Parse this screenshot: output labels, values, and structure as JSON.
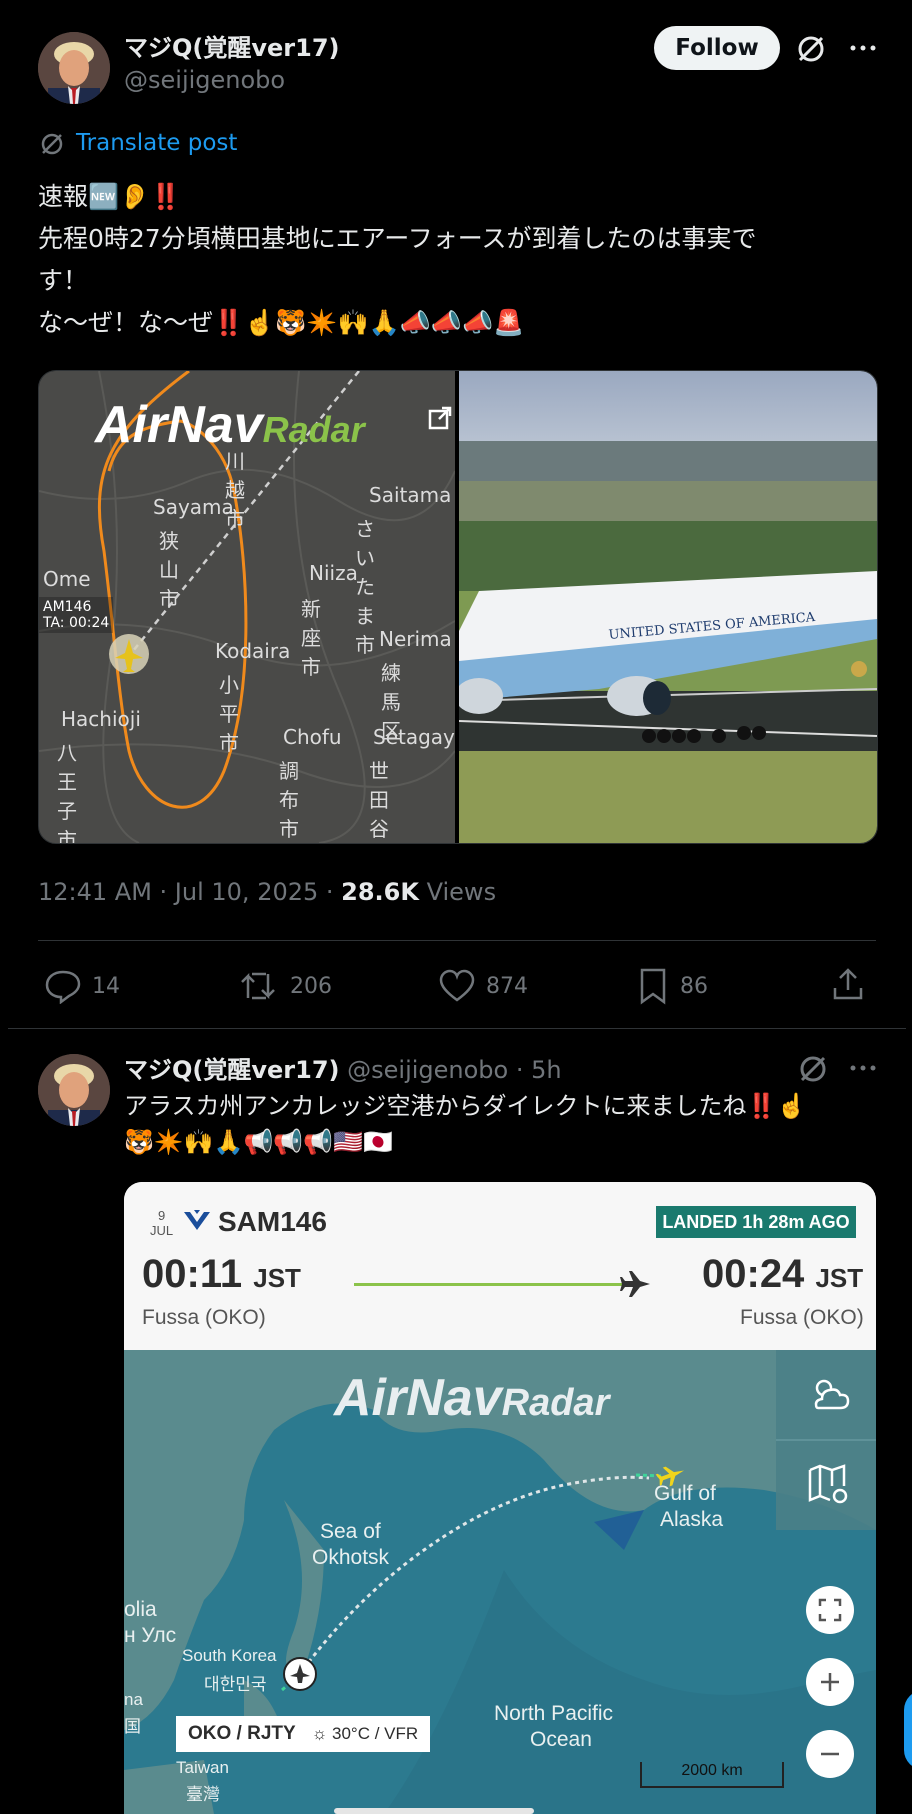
{
  "tweet1": {
    "author_name": "マジQ(覚醒ver17)",
    "author_handle": "@seijigenobo",
    "follow_label": "Follow",
    "translate_label": "Translate post",
    "lines": [
      "速報🆕👂‼️",
      "先程0時27分頃横田基地にエアーフォースが到着したのは事実で",
      "す！",
      "な〜ぜ！な〜ぜ‼️☝️🐯✴️🙌🙏📣📣📣🚨"
    ],
    "map": {
      "logo_main": "AirNav",
      "logo_sub": "Radar",
      "labels": [
        "川越市",
        "Sayama",
        "狭山市",
        "Saitama",
        "さいたま市",
        "Ome",
        "Niiza",
        "新座市",
        "Kodaira",
        "小平市",
        "Nerima",
        "練馬区",
        "Hachioji",
        "八王子市",
        "Chofu",
        "調布市",
        "Setagaya",
        "世田谷区"
      ],
      "flight_tag_1": "AM146",
      "flight_tag_2": "TA: 00:24"
    },
    "photo_text": "UNITED STATES OF AMERICA",
    "meta_time": "12:41 AM · Jul 10, 2025 · ",
    "views_count": "28.6K",
    "views_label": "Views",
    "stats": {
      "replies": "14",
      "reposts": "206",
      "likes": "874",
      "bookmarks": "86"
    }
  },
  "tweet2": {
    "author_name": "マジQ(覚醒ver17)",
    "author_handle": "@seijigenobo",
    "age": "· 5h",
    "line1": "アラスカ州アンカレッジ空港からダイレクトに来ましたね‼️☝️",
    "line2": "🐯✴️🙌🙏📢📢📢🇺🇸🇯🇵",
    "card": {
      "day": "9",
      "month": "JUL",
      "flight": "SAM146",
      "status": "LANDED 1h 28m AGO",
      "dep_time": "00:11",
      "dep_tz": "JST",
      "dep_place": "Fussa (OKO)",
      "arr_time": "00:24",
      "arr_tz": "JST",
      "arr_place": "Fussa (OKO)",
      "logo_main": "AirNav",
      "logo_sub": "Radar",
      "labels": [
        "Sea of",
        "Okhotsk",
        "Gulf of",
        "Alaska",
        "olia",
        "н Улс",
        "South Korea",
        "대한민국",
        "na",
        "国",
        "Taiwan",
        "臺灣",
        "North Pacific",
        "Ocean"
      ],
      "station": "OKO / RJTY",
      "weather": "30°C / VFR",
      "scale": "2000 km"
    }
  },
  "colors": {
    "accent": "#1d9bf0",
    "landed_bg": "#1a7a6e",
    "route_orange": "#f08a1c",
    "progress_green": "#8bc34a"
  }
}
